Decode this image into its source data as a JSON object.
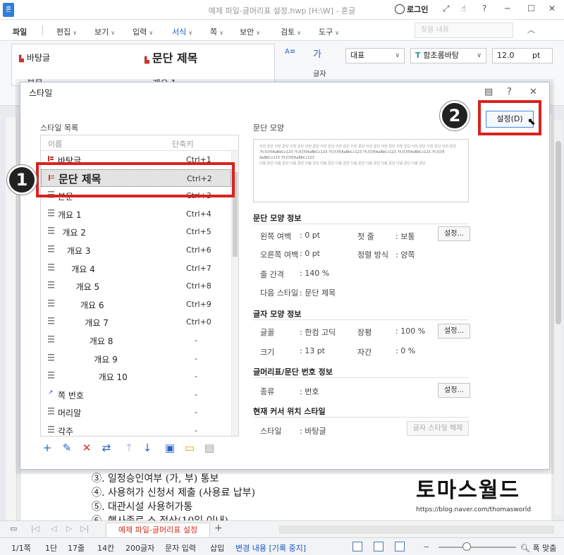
{
  "window": {
    "title": "예제 파일-글머리표 설정.hwp [H:\\W] - 혼글",
    "login": "로그인"
  },
  "menu": {
    "items": [
      "파일",
      "편집",
      "보기",
      "입력",
      "서식",
      "쪽",
      "보안",
      "검토",
      "도구"
    ],
    "active": "서식",
    "find_placeholder": "찾을 내용"
  },
  "ribbon": {
    "gallery": [
      "바탕글",
      "문단 제목",
      "본문",
      "개요 1"
    ],
    "lang_select": "대표",
    "font_select": "함초롬바탕",
    "size_select": "12.0",
    "size_unit": "pt",
    "char_label": "글자"
  },
  "dialog": {
    "title": "스타일",
    "list_label": "스타일 목록",
    "col_name": "이름",
    "col_shortcut": "단축키",
    "styles": [
      {
        "name": "바탕글",
        "shortcut": "Ctrl+1",
        "indent": 0,
        "type": "char"
      },
      {
        "name": "문단 제목",
        "shortcut": "Ctrl+2",
        "indent": 0,
        "type": "char",
        "selected": true
      },
      {
        "name": "본문",
        "shortcut": "Ctrl+3",
        "indent": 0,
        "type": "para"
      },
      {
        "name": "개요 1",
        "shortcut": "Ctrl+4",
        "indent": 0,
        "type": "para"
      },
      {
        "name": "개요 2",
        "shortcut": "Ctrl+5",
        "indent": 1,
        "type": "para"
      },
      {
        "name": "개요 3",
        "shortcut": "Ctrl+6",
        "indent": 2,
        "type": "para"
      },
      {
        "name": "개요 4",
        "shortcut": "Ctrl+7",
        "indent": 3,
        "type": "para"
      },
      {
        "name": "개요 5",
        "shortcut": "Ctrl+8",
        "indent": 4,
        "type": "para"
      },
      {
        "name": "개요 6",
        "shortcut": "Ctrl+9",
        "indent": 5,
        "type": "para"
      },
      {
        "name": "개요 7",
        "shortcut": "Ctrl+0",
        "indent": 6,
        "type": "para"
      },
      {
        "name": "개요 8",
        "shortcut": "-",
        "indent": 7,
        "type": "para"
      },
      {
        "name": "개요 9",
        "shortcut": "-",
        "indent": 8,
        "type": "para"
      },
      {
        "name": "개요 10",
        "shortcut": "-",
        "indent": 9,
        "type": "para"
      },
      {
        "name": "쪽 번호",
        "shortcut": "-",
        "indent": 0,
        "type": "page"
      },
      {
        "name": "머리말",
        "shortcut": "-",
        "indent": 0,
        "type": "para"
      },
      {
        "name": "각주",
        "shortcut": "-",
        "indent": 0,
        "type": "para"
      }
    ],
    "preview_label": "문단 모양",
    "preview_lines": [
      "이전 문단 이전 문단 이전 문단 이전 문단 이전 문단 이전 문단 이전 문단 이전 문단 이전 문단 이전 문단 이전 문단 이전 문단 이전 문단",
      "가나다라AaBbCc123 가나다라AaBbCc123 가나다라AaBbCc123 가나다라AaBbCc123 가나다라AaBbCc123 가나다라AaBbCc123 가나다라AaBbCc123",
      "다음 문단 다음 문단 다음 문단 다음 문단 다음 문단 다음 문단 다음 문단 다음 문단 다음 문단 다음 문단 다음 문단"
    ],
    "para_info_title": "문단 모양 정보",
    "para": {
      "left_margin_label": "왼쪽 여백",
      "left_margin": ": 0 pt",
      "first_line_label": "첫 줄",
      "first_line": ": 보통",
      "right_margin_label": "오른쪽 여백",
      "right_margin": ": 0 pt",
      "align_label": "정렬 방식",
      "align": ": 양쪽",
      "line_spacing_label": "줄 간격",
      "line_spacing": ": 140 %",
      "next_style_label": "다음 스타일",
      "next_style": ": 문단 제목"
    },
    "char_info_title": "글자 모양 정보",
    "char": {
      "font_label": "글꼴",
      "font": ": 한컴 고딕",
      "ratio_label": "장평",
      "ratio": ": 100 %",
      "size_label": "크기",
      "size": ": 13 pt",
      "spacing_label": "자간",
      "spacing": ": 0 %"
    },
    "bullet_info_title": "글머리표/문단 번호 정보",
    "bullet": {
      "type_label": "종류",
      "type": ": 번호"
    },
    "cursor_info_title": "현재 커서 위치 스타일",
    "cursor": {
      "style_label": "스타일",
      "style": ": 바탕글"
    },
    "settings_button": "설정(D)",
    "set_button": "설정...",
    "clear_char_style": "글자 스타일 해제"
  },
  "annotations": {
    "badge1": "1",
    "badge2": "2"
  },
  "document": {
    "lines": [
      "③. 일정승인여부 (가, 부) 통보",
      "④. 사용허가 신청서 제출 (사용료 납부)",
      "⑤. 대관시설 사용허가통",
      "⑥. 행사종료 소 정산(10일 이내)"
    ]
  },
  "watermark": {
    "title": "토마스월드",
    "url": "https://blog.naver.com/thomasworld"
  },
  "tabs": {
    "doc_tab": "예제 파일-글머리표 설정"
  },
  "status": {
    "page": "1/1쪽",
    "section": "1단",
    "line": "17줄",
    "col": "14칸",
    "chars": "200글자",
    "mode": "문자 입력",
    "insert": "삽입",
    "track": "변경 내용 [기록 중지]",
    "zoom": "폭 맞춤"
  },
  "colors": {
    "accent": "#1a56c4",
    "annotation": "#d8221f",
    "tab_text": "#d0301f"
  }
}
